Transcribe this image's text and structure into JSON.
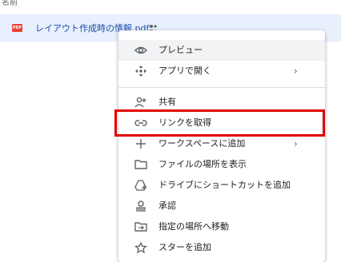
{
  "column_header": "名前",
  "file": {
    "icon_text": "PDF",
    "name": "レイアウト作成時の情報.pdf",
    "shared_icon": "people-icon"
  },
  "context_menu": {
    "items": [
      {
        "label": "プレビュー",
        "icon": "eye-icon"
      },
      {
        "label": "アプリで開く",
        "icon": "move-arrows-icon",
        "submenu": "›"
      },
      {
        "label": "共有",
        "icon": "person-add-icon"
      },
      {
        "label": "リンクを取得",
        "icon": "link-icon"
      },
      {
        "label": "ワークスペースに追加",
        "icon": "plus-icon",
        "submenu": "›"
      },
      {
        "label": "ファイルの場所を表示",
        "icon": "folder-icon"
      },
      {
        "label": "ドライブにショートカットを追加",
        "icon": "drive-shortcut-icon"
      },
      {
        "label": "承認",
        "icon": "approval-icon"
      },
      {
        "label": "指定の場所へ移動",
        "icon": "move-to-folder-icon"
      },
      {
        "label": "スターを追加",
        "icon": "star-icon"
      }
    ]
  },
  "highlight_color": "#e00000"
}
